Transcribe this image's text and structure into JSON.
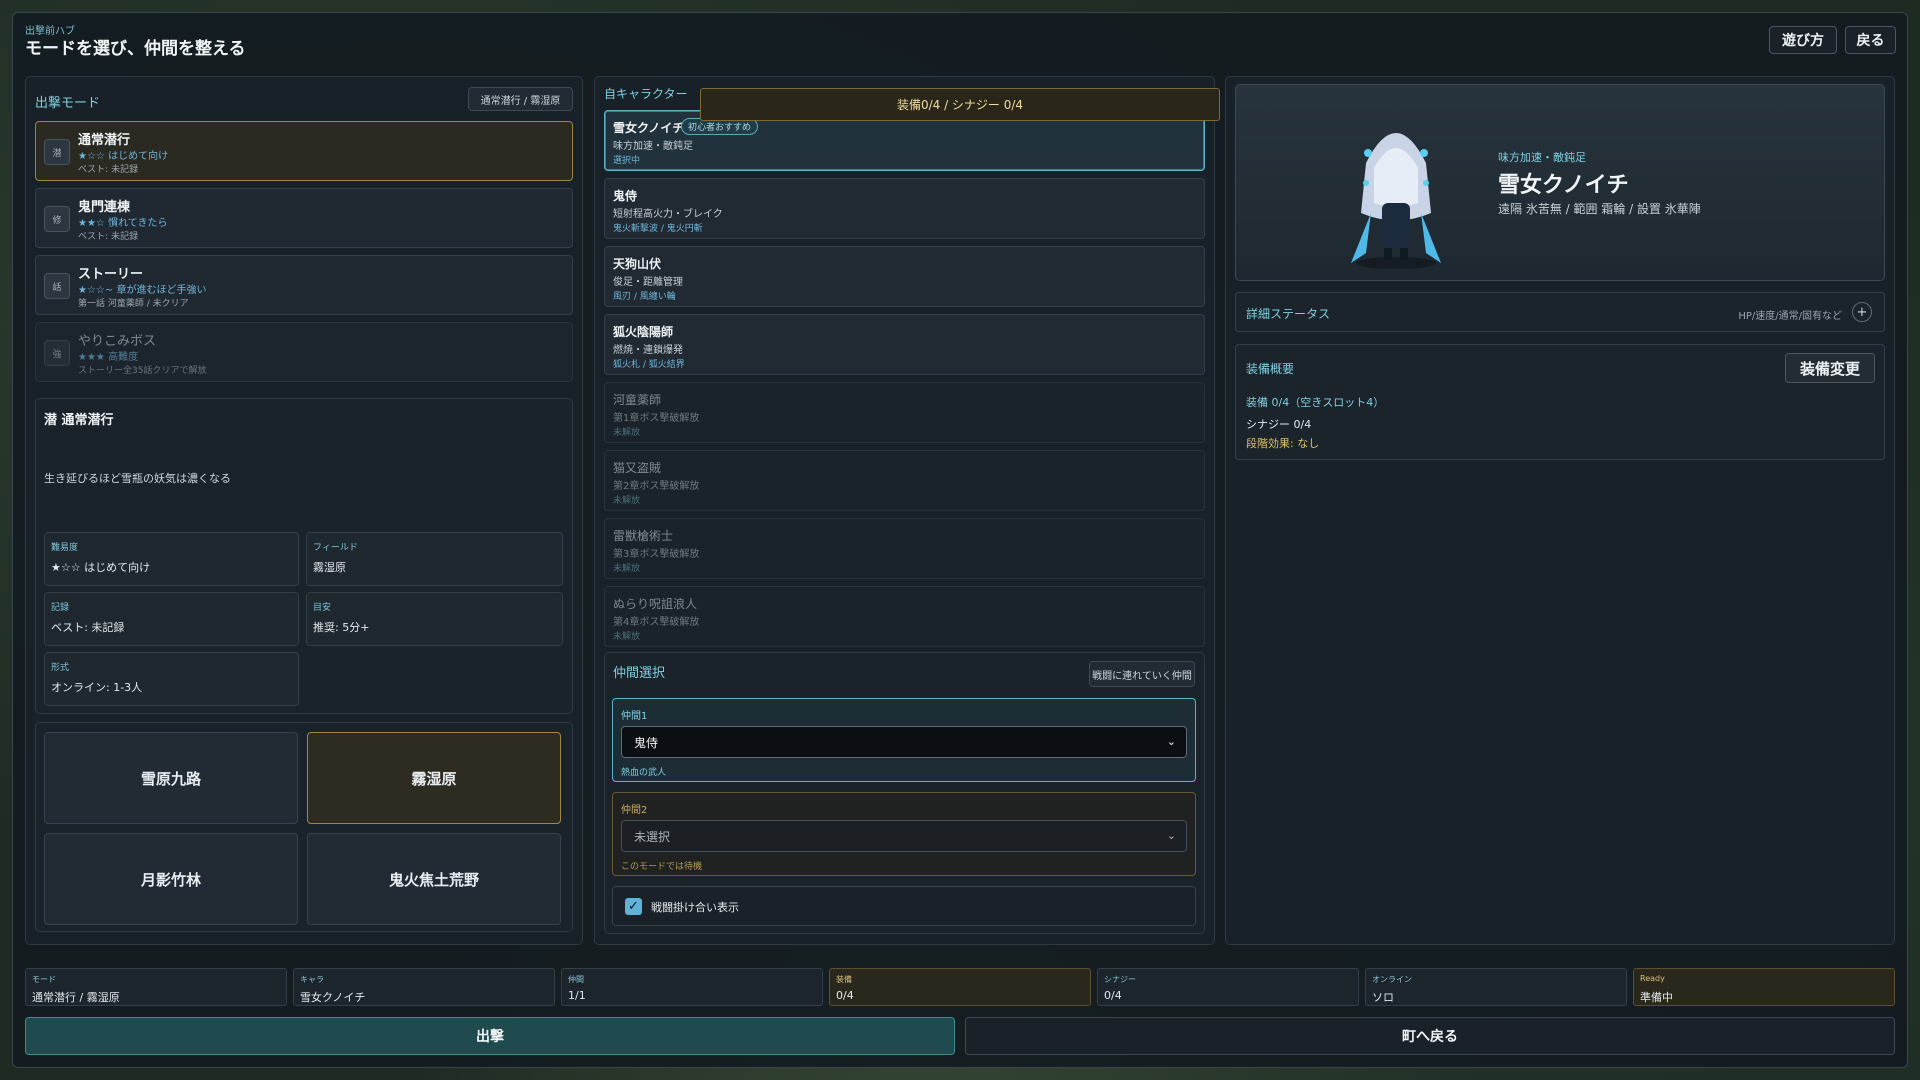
{
  "header": {
    "sub": "出撃前ハブ",
    "title": "モードを選び、仲間を整える",
    "howto": "遊び方",
    "back": "戻る"
  },
  "modes": {
    "title": "出撃モード",
    "chip": "通常潜行 / 霧湿原",
    "items": [
      {
        "icon": "潜",
        "name": "通常潜行",
        "stars": "★☆☆ はじめて向け",
        "best": "ベスト: 未記録"
      },
      {
        "icon": "修",
        "name": "鬼門連棟",
        "stars": "★★☆ 慣れてきたら",
        "best": "ベスト: 未記録"
      },
      {
        "icon": "話",
        "name": "ストーリー",
        "stars": "★☆☆~ 章が進むほど手強い",
        "best": "第一話 河童薬師 / 未クリア"
      },
      {
        "icon": "強",
        "name": "やりこみボス",
        "stars": "★★★ 高難度",
        "best": "ストーリー全35話クリアで解放"
      }
    ]
  },
  "detail": {
    "title": "潜 通常潜行",
    "desc": "生き延びるほど雪瓶の妖気は濃くなる",
    "cells": [
      {
        "label": "難易度",
        "value": "★☆☆ はじめて向け"
      },
      {
        "label": "フィールド",
        "value": "霧湿原"
      },
      {
        "label": "記録",
        "value": "ベスト: 未記録"
      },
      {
        "label": "目安",
        "value": "推奨: 5分+"
      },
      {
        "label": "形式",
        "value": "オンライン: 1-3人"
      }
    ]
  },
  "fields": [
    "雪原九路",
    "霧湿原",
    "月影竹林",
    "鬼火焦土荒野"
  ],
  "chars": {
    "title": "自キャラクター",
    "tooltip": "装備0/4 / シナジー 0/4",
    "recommend": "初心者おすすめ",
    "items": [
      {
        "name": "雪女クノイチ",
        "role": "味方加速・敵鈍足",
        "sub": "選択中"
      },
      {
        "name": "鬼侍",
        "role": "短射程高火力・ブレイク",
        "sub": "鬼火斬撃波 / 鬼火円斬"
      },
      {
        "name": "天狗山伏",
        "role": "俊足・距離管理",
        "sub": "風刃 / 風纏い輪"
      },
      {
        "name": "狐火陰陽師",
        "role": "燃焼・連鎖爆発",
        "sub": "狐火札 / 狐火結界"
      },
      {
        "name": "河童薬師",
        "role": "第1章ボス撃破解放",
        "sub": "未解放"
      },
      {
        "name": "猫又盗賊",
        "role": "第2章ボス撃破解放",
        "sub": "未解放"
      },
      {
        "name": "雷獣槍術士",
        "role": "第3章ボス撃破解放",
        "sub": "未解放"
      },
      {
        "name": "ぬらり呪詛浪人",
        "role": "第4章ボス撃破解放",
        "sub": "未解放"
      }
    ]
  },
  "companions": {
    "title": "仲間選択",
    "chip": "戦闘に連れていく仲間",
    "slot1": {
      "label": "仲間1",
      "value": "鬼侍",
      "note": "熱血の武人"
    },
    "slot2": {
      "label": "仲間2",
      "value": "未選択",
      "note": "このモードでは待機"
    },
    "toggle": "戦闘掛け合い表示",
    "toggle_checked": true
  },
  "preview": {
    "role": "味方加速・敵鈍足",
    "name": "雪女クノイチ",
    "skills": "遠隔 氷苦無 / 範囲 霜輪 / 設置 氷華陣"
  },
  "status": {
    "title": "詳細ステータス",
    "hint": "HP/速度/通常/固有など",
    "expand": "+"
  },
  "equip": {
    "title": "装備概要",
    "change": "装備変更",
    "slots": "装備 0/4（空きスロット4）",
    "synergy": "シナジー 0/4",
    "effect": "段階効果: なし"
  },
  "summary": [
    {
      "label": "モード",
      "value": "通常潜行 / 霧湿原"
    },
    {
      "label": "キャラ",
      "value": "雪女クノイチ"
    },
    {
      "label": "仲間",
      "value": "1/1"
    },
    {
      "label": "装備",
      "value": "0/4"
    },
    {
      "label": "シナジー",
      "value": "0/4"
    },
    {
      "label": "オンライン",
      "value": "ソロ"
    },
    {
      "label": "Ready",
      "value": "準備中"
    }
  ],
  "actions": {
    "sortie": "出撃",
    "town": "町へ戻る"
  }
}
